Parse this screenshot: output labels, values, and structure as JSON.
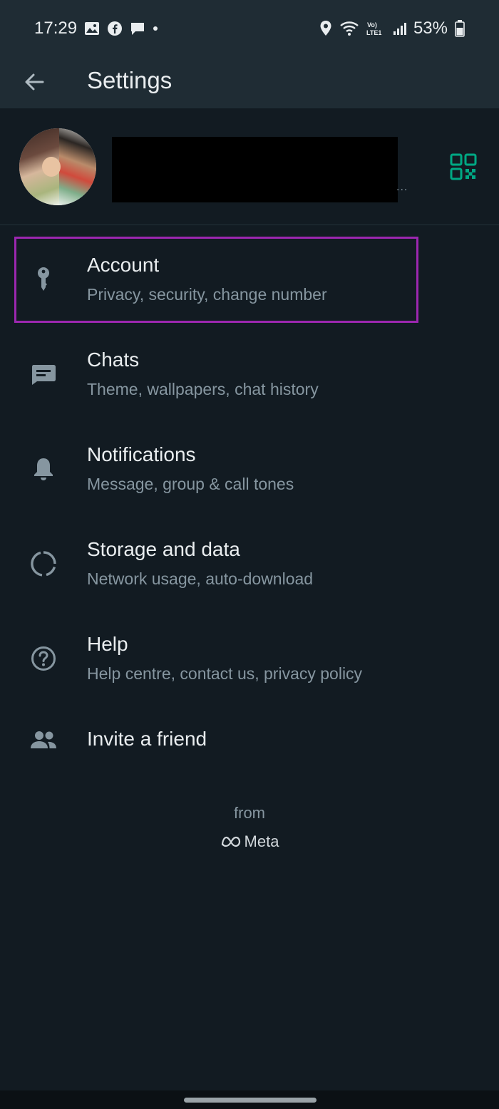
{
  "status_bar": {
    "time": "17:29",
    "battery_percent": "53%",
    "left_icons": [
      "gallery-icon",
      "facebook-icon",
      "message-icon",
      "dot-icon"
    ],
    "right_icons": [
      "location-icon",
      "wifi-icon",
      "volte-icon",
      "signal-icon",
      "battery-icon"
    ],
    "volte_label": "Vo) LTE1"
  },
  "app_bar": {
    "title": "Settings",
    "back_icon": "arrow-back-icon"
  },
  "profile": {
    "avatar_icon": "profile-photo",
    "qr_icon": "qr-code-icon",
    "ellipsis": "..."
  },
  "menu": [
    {
      "title": "Account",
      "subtitle": "Privacy, security, change number",
      "icon": "key-icon"
    },
    {
      "title": "Chats",
      "subtitle": "Theme, wallpapers, chat history",
      "icon": "chat-icon"
    },
    {
      "title": "Notifications",
      "subtitle": "Message, group & call tones",
      "icon": "bell-icon"
    },
    {
      "title": "Storage and data",
      "subtitle": "Network usage, auto-download",
      "icon": "storage-icon"
    },
    {
      "title": "Help",
      "subtitle": "Help centre, contact us, privacy policy",
      "icon": "help-icon"
    },
    {
      "title": "Invite a friend",
      "icon": "people-icon"
    }
  ],
  "footer": {
    "from_label": "from",
    "brand": "Meta"
  },
  "colors": {
    "background": "#121b22",
    "app_bar": "#1f2c34",
    "highlight": "#9c27b0",
    "qr_accent": "#00a884",
    "primary_text": "#e9edef",
    "secondary_text": "#8696a0"
  }
}
